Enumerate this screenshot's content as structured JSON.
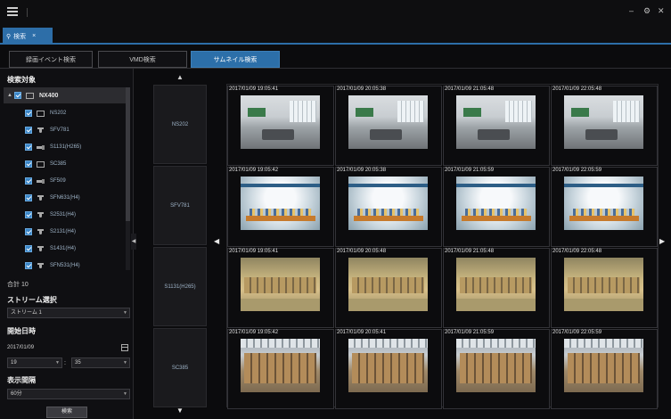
{
  "window": {
    "minimize_glyph": "–",
    "settings_glyph": "⚙",
    "close_glyph": "✕"
  },
  "tab": {
    "label": "検索",
    "close": "×"
  },
  "mode_tabs": [
    "録画イベント検索",
    "VMD検索",
    "サムネイル検索"
  ],
  "active_mode_index": 2,
  "left": {
    "target_title": "検索対象",
    "root": "NX400",
    "cameras": [
      {
        "name": "NS202",
        "icon": "box-camera-icon"
      },
      {
        "name": "SFV781",
        "icon": "dome-camera-icon"
      },
      {
        "name": "S1131(H265)",
        "icon": "bullet-camera-icon"
      },
      {
        "name": "SC385",
        "icon": "box-camera-icon"
      },
      {
        "name": "SF509",
        "icon": "bullet-camera-icon"
      },
      {
        "name": "SFN631(H4)",
        "icon": "dome-camera-icon"
      },
      {
        "name": "S2531(H4)",
        "icon": "dome-camera-icon"
      },
      {
        "name": "S2131(H4)",
        "icon": "dome-camera-icon"
      },
      {
        "name": "S1431(H4)",
        "icon": "dome-camera-icon"
      },
      {
        "name": "SFN531(H4)",
        "icon": "dome-camera-icon"
      }
    ],
    "total_label": "合計",
    "total_value": "10",
    "stream_title": "ストリーム選択",
    "stream_value": "ストリーム 1",
    "start_title": "開始日時",
    "start_date": "2017/01/09",
    "start_hour": "19",
    "start_minute": "35",
    "interval_title": "表示間隔",
    "interval_value": "60分",
    "search_button": "検索"
  },
  "grid": {
    "rows": [
      {
        "camera": "NS202",
        "scene": "office",
        "timestamps": [
          "2017/01/09 19:05:41",
          "2017/01/09 20:05:38",
          "2017/01/09 21:05:48",
          "2017/01/09 22:05:48"
        ]
      },
      {
        "camera": "SFV781",
        "scene": "atrium",
        "timestamps": [
          "2017/01/09 19:05:42",
          "2017/01/09 20:05:38",
          "2017/01/09 21:05:59",
          "2017/01/09 22:05:59"
        ]
      },
      {
        "camera": "S1131(H265)",
        "scene": "warehouse",
        "timestamps": [
          "2017/01/09 19:05:41",
          "2017/01/09 20:05:48",
          "2017/01/09 21:05:48",
          "2017/01/09 22:05:48"
        ]
      },
      {
        "camera": "SC385",
        "scene": "boxes",
        "timestamps": [
          "2017/01/09 19:05:42",
          "2017/01/09 20:05:41",
          "2017/01/09 21:05:59",
          "2017/01/09 22:05:59"
        ]
      }
    ]
  },
  "nav": {
    "up": "▲",
    "down": "▼",
    "left": "◀",
    "right": "▶"
  }
}
